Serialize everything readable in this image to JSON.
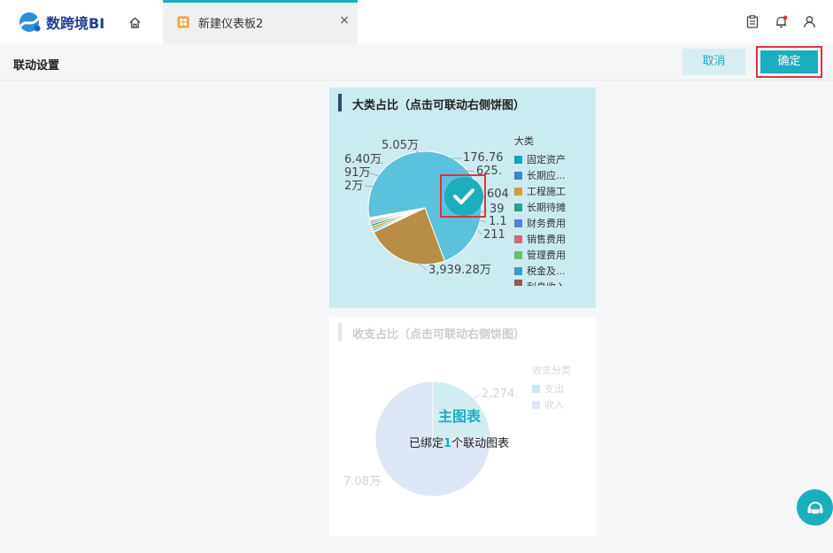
{
  "app": {
    "logo_text": "数跨境BI"
  },
  "tab": {
    "label": "新建仪表板2",
    "close": "×"
  },
  "settings": {
    "title": "联动设置",
    "cancel_label": "取消",
    "confirm_label": "确定"
  },
  "card1": {
    "title": "大类占比（点击可联动右侧饼图）",
    "legend_title": "大类",
    "legend": [
      {
        "label": "固定资产",
        "color": "#17a4b5"
      },
      {
        "label": "长期应...",
        "color": "#3f86c9"
      },
      {
        "label": "工程施工",
        "color": "#c9a238"
      },
      {
        "label": "长期待摊",
        "color": "#21a48a"
      },
      {
        "label": "财务费用",
        "color": "#5b7fd6"
      },
      {
        "label": "销售费用",
        "color": "#c56f82"
      },
      {
        "label": "管理费用",
        "color": "#6cbd70"
      },
      {
        "label": "税金及...",
        "color": "#3f9bbf"
      },
      {
        "label": "利息收入",
        "color": "#8e5a5a"
      }
    ],
    "labels": [
      "5.05万",
      "6.40万",
      "91万",
      "2万",
      "176.76",
      "625.",
      "604",
      "39",
      "1.1",
      "211",
      "3,939.28万"
    ],
    "slices": [
      {
        "value": 3939.28,
        "color": "#5bc1dc"
      },
      {
        "value": 1290,
        "color": "#b88e47"
      },
      {
        "value": 20,
        "color": "#3f86c9"
      },
      {
        "value": 30,
        "color": "#17a4b5"
      },
      {
        "value": 44,
        "color": "#c9a238"
      },
      {
        "value": 36,
        "color": "#21a48a"
      },
      {
        "value": 26,
        "color": "#5b7fd6"
      },
      {
        "value": 30,
        "color": "#c56f82"
      },
      {
        "value": 18,
        "color": "#6cbd70"
      },
      {
        "value": 16,
        "color": "#3f9bbf"
      },
      {
        "value": 14,
        "color": "#8e5a5a"
      }
    ]
  },
  "card2": {
    "title": "收支占比（点击可联动右侧饼图）",
    "legend_title": "收支分类",
    "legend": [
      {
        "label": "支出",
        "color": "#c7e9ef"
      },
      {
        "label": "收入",
        "color": "#dde7f6"
      }
    ],
    "labels": [
      "2,274.",
      "7.08万"
    ],
    "slices": [
      {
        "value": 25,
        "color": "#d2eef2"
      },
      {
        "value": 75,
        "color": "#dde7f6"
      }
    ],
    "main_chart_label": "主图表",
    "bound_prefix": "已绑定",
    "bound_count": "1",
    "bound_suffix": "个联动图表"
  }
}
